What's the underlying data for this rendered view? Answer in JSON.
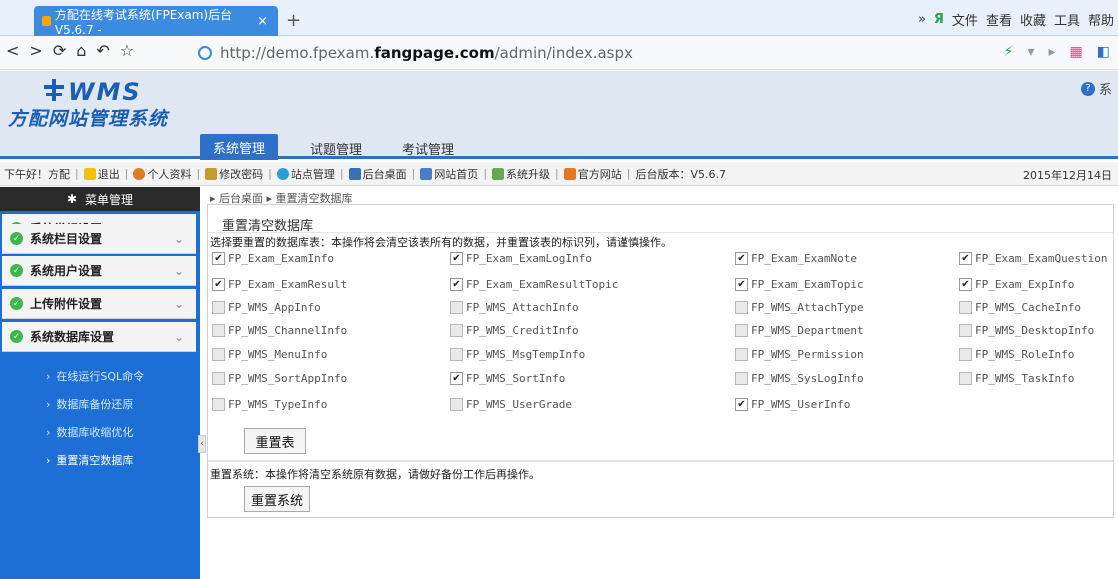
{
  "browser": {
    "tab_title": "方配在线考试系统(FPExam)后台 V5.6.7 -",
    "tab_close": "×",
    "new_tab": "+",
    "menu": [
      "文件",
      "查看",
      "收藏",
      "工具",
      "帮助"
    ],
    "url_prefix": "http://demo.fpexam.",
    "url_domain": "fangpage.com",
    "url_path": "/admin/index.aspx"
  },
  "header": {
    "logo_text": "WMS",
    "logo_cn": "方配网站管理系统",
    "help_label": "系",
    "tabs": [
      "系统管理",
      "试题管理",
      "考试管理"
    ]
  },
  "quickbar": {
    "greeting": "下午好！方配",
    "items": [
      "退出",
      "个人资料",
      "修改密码",
      "站点管理",
      "后台桌面",
      "网站首页",
      "系统升级",
      "官方网站"
    ],
    "version": "后台版本：V5.6.7",
    "date": "2015年12月14日"
  },
  "sidebar": {
    "head": "菜单管理",
    "sections": [
      "系统常规设置",
      "系统栏目设置",
      "系统用户设置",
      "上传附件设置",
      "系统数据库设置"
    ],
    "subitems": [
      "在线运行SQL命令",
      "数据库备份还原",
      "数据库收缩优化",
      "重置清空数据库"
    ]
  },
  "content": {
    "breadcrumb": "▸ 后台桌面 ▸ 重置清空数据库",
    "title": "重置清空数据库",
    "instruction": "选择要重置的数据库表：本操作将会清空该表所有的数据，并重置该表的标识列，请谨慎操作。",
    "tables": [
      {
        "name": "FP_Exam_ExamInfo",
        "checked": true
      },
      {
        "name": "FP_Exam_ExamLogInfo",
        "checked": true
      },
      {
        "name": "FP_Exam_ExamNote",
        "checked": true
      },
      {
        "name": "FP_Exam_ExamQuestion",
        "checked": true
      },
      {
        "name": "FP_Exam_ExamResult",
        "checked": true
      },
      {
        "name": "FP_Exam_ExamResultTopic",
        "checked": true
      },
      {
        "name": "FP_Exam_ExamTopic",
        "checked": true
      },
      {
        "name": "FP_Exam_ExpInfo",
        "checked": true
      },
      {
        "name": "FP_WMS_AppInfo",
        "checked": false
      },
      {
        "name": "FP_WMS_AttachInfo",
        "checked": false
      },
      {
        "name": "FP_WMS_AttachType",
        "checked": false
      },
      {
        "name": "FP_WMS_CacheInfo",
        "checked": false
      },
      {
        "name": "FP_WMS_ChannelInfo",
        "checked": false
      },
      {
        "name": "FP_WMS_CreditInfo",
        "checked": false
      },
      {
        "name": "FP_WMS_Department",
        "checked": false
      },
      {
        "name": "FP_WMS_DesktopInfo",
        "checked": false
      },
      {
        "name": "FP_WMS_MenuInfo",
        "checked": false
      },
      {
        "name": "FP_WMS_MsgTempInfo",
        "checked": false
      },
      {
        "name": "FP_WMS_Permission",
        "checked": false
      },
      {
        "name": "FP_WMS_RoleInfo",
        "checked": false
      },
      {
        "name": "FP_WMS_SortAppInfo",
        "checked": false
      },
      {
        "name": "FP_WMS_SortInfo",
        "checked": true
      },
      {
        "name": "FP_WMS_SysLogInfo",
        "checked": false
      },
      {
        "name": "FP_WMS_TaskInfo",
        "checked": false
      },
      {
        "name": "FP_WMS_TypeInfo",
        "checked": false
      },
      {
        "name": "FP_WMS_UserGrade",
        "checked": false
      },
      {
        "name": "FP_WMS_UserInfo",
        "checked": true
      }
    ],
    "reset_table_button": "重置表",
    "system_note": "重置系统：本操作将清空系统原有数据，请做好备份工作后再操作。",
    "reset_system_button": "重置系统"
  }
}
